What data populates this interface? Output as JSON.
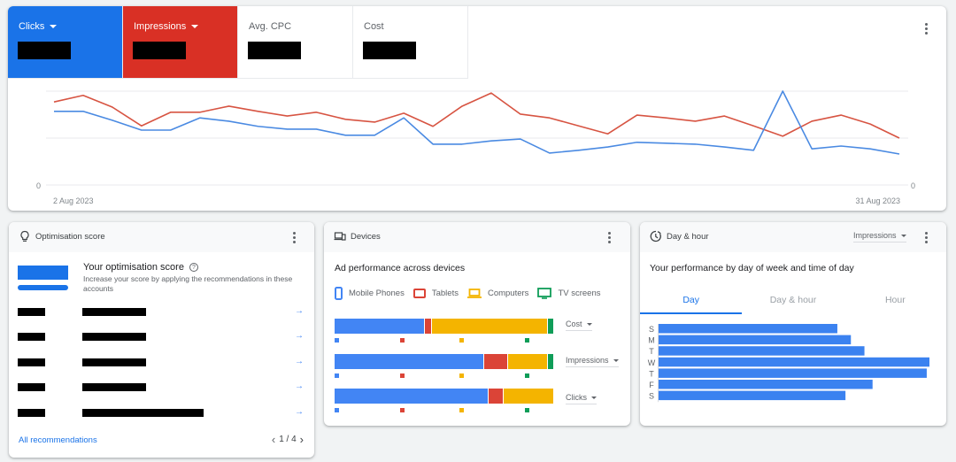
{
  "overview": {
    "metrics": [
      {
        "label": "Clicks",
        "has_dropdown": true,
        "state": "selected",
        "color": "#1a73e8",
        "value": "[redacted]"
      },
      {
        "label": "Impressions",
        "has_dropdown": true,
        "state": "selected",
        "color": "#d93025",
        "value": "[redacted]"
      },
      {
        "label": "Avg. CPC",
        "has_dropdown": false,
        "state": "unselected",
        "value": "[redacted]"
      },
      {
        "label": "Cost",
        "has_dropdown": false,
        "state": "unselected",
        "value": "[redacted]"
      }
    ],
    "menu_icon": "more-vert-icon"
  },
  "chart_data": {
    "type": "line",
    "title": "",
    "x_start_label": "2 Aug 2023",
    "x_end_label": "31 Aug 2023",
    "y_left_zero_label": "0",
    "y_right_zero_label": "0",
    "y_scale_note": "values normalized; only 0 labeled on both axes; gridlines at 0, 1, 2",
    "ylim": [
      0,
      2
    ],
    "grid": true,
    "x": [
      "2 Aug",
      "3 Aug",
      "4 Aug",
      "5 Aug",
      "6 Aug",
      "7 Aug",
      "8 Aug",
      "9 Aug",
      "10 Aug",
      "11 Aug",
      "12 Aug",
      "13 Aug",
      "14 Aug",
      "15 Aug",
      "16 Aug",
      "17 Aug",
      "18 Aug",
      "19 Aug",
      "20 Aug",
      "21 Aug",
      "22 Aug",
      "23 Aug",
      "24 Aug",
      "25 Aug",
      "26 Aug",
      "27 Aug",
      "28 Aug",
      "29 Aug",
      "30 Aug",
      "31 Aug"
    ],
    "series": [
      {
        "name": "Impressions",
        "color": "#d75442",
        "axis": "right",
        "values": [
          1.77,
          1.91,
          1.66,
          1.26,
          1.55,
          1.55,
          1.68,
          1.57,
          1.47,
          1.55,
          1.4,
          1.34,
          1.53,
          1.25,
          1.68,
          1.96,
          1.51,
          1.43,
          1.26,
          1.09,
          1.49,
          1.43,
          1.36,
          1.47,
          1.26,
          1.04,
          1.36,
          1.49,
          1.3,
          1.0
        ]
      },
      {
        "name": "Clicks",
        "color": "#4a8ae2",
        "axis": "left",
        "values": [
          1.57,
          1.57,
          1.38,
          1.17,
          1.17,
          1.43,
          1.36,
          1.25,
          1.19,
          1.19,
          1.06,
          1.06,
          1.43,
          0.87,
          0.87,
          0.94,
          0.98,
          0.68,
          0.74,
          0.81,
          0.91,
          0.89,
          0.87,
          0.81,
          0.74,
          2.0,
          0.77,
          0.83,
          0.77,
          0.66
        ]
      }
    ]
  },
  "optimisation": {
    "title": "Optimisation score",
    "icon": "lightbulb-icon",
    "score_title": "Your optimisation score",
    "score_value": "[redacted]",
    "help_icon": "help-icon",
    "description": "Increase your score by applying the recommendations in these accounts",
    "recommendations": [
      {
        "name": "[redacted]",
        "detail": "[redacted]",
        "arrow": "→"
      },
      {
        "name": "[redacted]",
        "detail": "[redacted]",
        "arrow": "→"
      },
      {
        "name": "[redacted]",
        "detail": "[redacted]",
        "arrow": "→"
      },
      {
        "name": "[redacted]",
        "detail": "[redacted]",
        "arrow": "→"
      },
      {
        "name": "[redacted]",
        "detail": "[redacted]",
        "arrow": "→"
      }
    ],
    "all_link": "All recommendations",
    "pager": "1 / 4",
    "prev": "‹",
    "next": "›"
  },
  "devices": {
    "title": "Devices",
    "icon": "devices-icon",
    "subtitle": "Ad performance across devices",
    "legend": [
      {
        "label": "Mobile Phones",
        "color": "#4285f4",
        "icon": "phone-icon"
      },
      {
        "label": "Tablets",
        "color": "#db4437",
        "icon": "tablet-icon"
      },
      {
        "label": "Computers",
        "color": "#f4b400",
        "icon": "laptop-icon"
      },
      {
        "label": "TV screens",
        "color": "#0f9d58",
        "icon": "tv-icon"
      }
    ],
    "bars": [
      {
        "metric": "Cost",
        "shares": [
          0.41,
          0.03,
          0.53,
          0.03
        ]
      },
      {
        "metric": "Impressions",
        "shares": [
          0.68,
          0.11,
          0.18,
          0.03
        ]
      },
      {
        "metric": "Clicks",
        "shares": [
          0.7,
          0.07,
          0.23,
          0.0
        ]
      }
    ]
  },
  "dayhour": {
    "title": "Day & hour",
    "icon": "schedule-icon",
    "metric_select": "Impressions",
    "subtitle": "Your performance by day of week and time of day",
    "tabs": [
      {
        "label": "Day",
        "active": true
      },
      {
        "label": "Day & hour",
        "active": false
      },
      {
        "label": "Hour",
        "active": false
      }
    ],
    "days": [
      {
        "label": "S",
        "value": 0.66
      },
      {
        "label": "M",
        "value": 0.71
      },
      {
        "label": "T",
        "value": 0.76
      },
      {
        "label": "W",
        "value": 1.0
      },
      {
        "label": "T",
        "value": 0.99
      },
      {
        "label": "F",
        "value": 0.79
      },
      {
        "label": "S",
        "value": 0.69
      }
    ],
    "bar_color": "#3b82f0"
  }
}
